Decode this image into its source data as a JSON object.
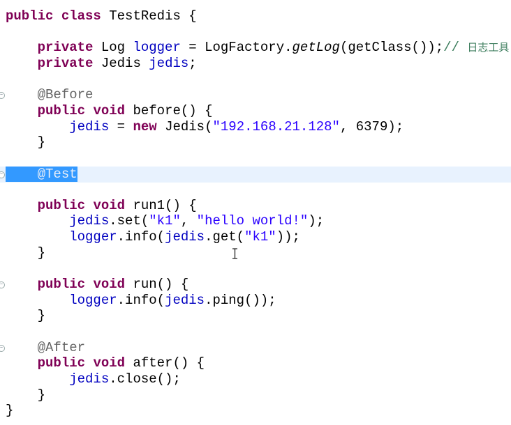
{
  "editor": {
    "current_line": 10,
    "selection_text": "@Test",
    "lines": [
      [
        {
          "t": "public",
          "c": "kw"
        },
        {
          "t": " "
        },
        {
          "t": "class",
          "c": "kw"
        },
        {
          "t": " TestRedis {"
        }
      ],
      [],
      [
        {
          "t": "    "
        },
        {
          "t": "private",
          "c": "kw"
        },
        {
          "t": " Log "
        },
        {
          "t": "logger",
          "c": "field"
        },
        {
          "t": " = LogFactory."
        },
        {
          "t": "getLog",
          "c": "it"
        },
        {
          "t": "(getClass());"
        },
        {
          "t": "// ",
          "c": "cmts"
        },
        {
          "t": "日志工具",
          "c": "cmt"
        }
      ],
      [
        {
          "t": "    "
        },
        {
          "t": "private",
          "c": "kw"
        },
        {
          "t": " Jedis "
        },
        {
          "t": "jedis",
          "c": "field"
        },
        {
          "t": ";"
        }
      ],
      [],
      [
        {
          "t": "    "
        },
        {
          "t": "@Before",
          "c": "ann"
        }
      ],
      [
        {
          "t": "    "
        },
        {
          "t": "public",
          "c": "kw"
        },
        {
          "t": " "
        },
        {
          "t": "void",
          "c": "kw"
        },
        {
          "t": " before() {"
        }
      ],
      [
        {
          "t": "        "
        },
        {
          "t": "jedis",
          "c": "field"
        },
        {
          "t": " = "
        },
        {
          "t": "new",
          "c": "kw"
        },
        {
          "t": " Jedis("
        },
        {
          "t": "\"192.168.21.128\"",
          "c": "str"
        },
        {
          "t": ", 6379);"
        }
      ],
      [
        {
          "t": "    }"
        }
      ],
      [],
      [
        {
          "t": "    ",
          "c": "sel"
        },
        {
          "t": "@Test",
          "c": "ann sel"
        }
      ],
      [],
      [
        {
          "t": "    "
        },
        {
          "t": "public",
          "c": "kw"
        },
        {
          "t": " "
        },
        {
          "t": "void",
          "c": "kw"
        },
        {
          "t": " run1() {"
        }
      ],
      [
        {
          "t": "        "
        },
        {
          "t": "jedis",
          "c": "field"
        },
        {
          "t": ".set("
        },
        {
          "t": "\"k1\"",
          "c": "str"
        },
        {
          "t": ", "
        },
        {
          "t": "\"hello world!\"",
          "c": "str"
        },
        {
          "t": ");"
        }
      ],
      [
        {
          "t": "        "
        },
        {
          "t": "logger",
          "c": "field"
        },
        {
          "t": ".info("
        },
        {
          "t": "jedis",
          "c": "field"
        },
        {
          "t": ".get("
        },
        {
          "t": "\"k1\"",
          "c": "str"
        },
        {
          "t": "));"
        }
      ],
      [
        {
          "t": "    }"
        }
      ],
      [],
      [
        {
          "t": "    "
        },
        {
          "t": "public",
          "c": "kw"
        },
        {
          "t": " "
        },
        {
          "t": "void",
          "c": "kw"
        },
        {
          "t": " run() {"
        }
      ],
      [
        {
          "t": "        "
        },
        {
          "t": "logger",
          "c": "field"
        },
        {
          "t": ".info("
        },
        {
          "t": "jedis",
          "c": "field"
        },
        {
          "t": ".ping());"
        }
      ],
      [
        {
          "t": "    }"
        }
      ],
      [],
      [
        {
          "t": "    "
        },
        {
          "t": "@After",
          "c": "ann"
        }
      ],
      [
        {
          "t": "    "
        },
        {
          "t": "public",
          "c": "kw"
        },
        {
          "t": " "
        },
        {
          "t": "void",
          "c": "kw"
        },
        {
          "t": " after() {"
        }
      ],
      [
        {
          "t": "        "
        },
        {
          "t": "jedis",
          "c": "field"
        },
        {
          "t": ".close();"
        }
      ],
      [
        {
          "t": "    }"
        }
      ],
      [
        {
          "t": "}"
        }
      ]
    ],
    "fold_lines": [
      5,
      10,
      17,
      21
    ]
  },
  "colors": {
    "keyword": "#7f0055",
    "field": "#0000c0",
    "string": "#2a00ff",
    "comment": "#3f7f5f",
    "annotation": "#646464",
    "current_line": "#e8f2fe",
    "selection": "#3399ff"
  }
}
